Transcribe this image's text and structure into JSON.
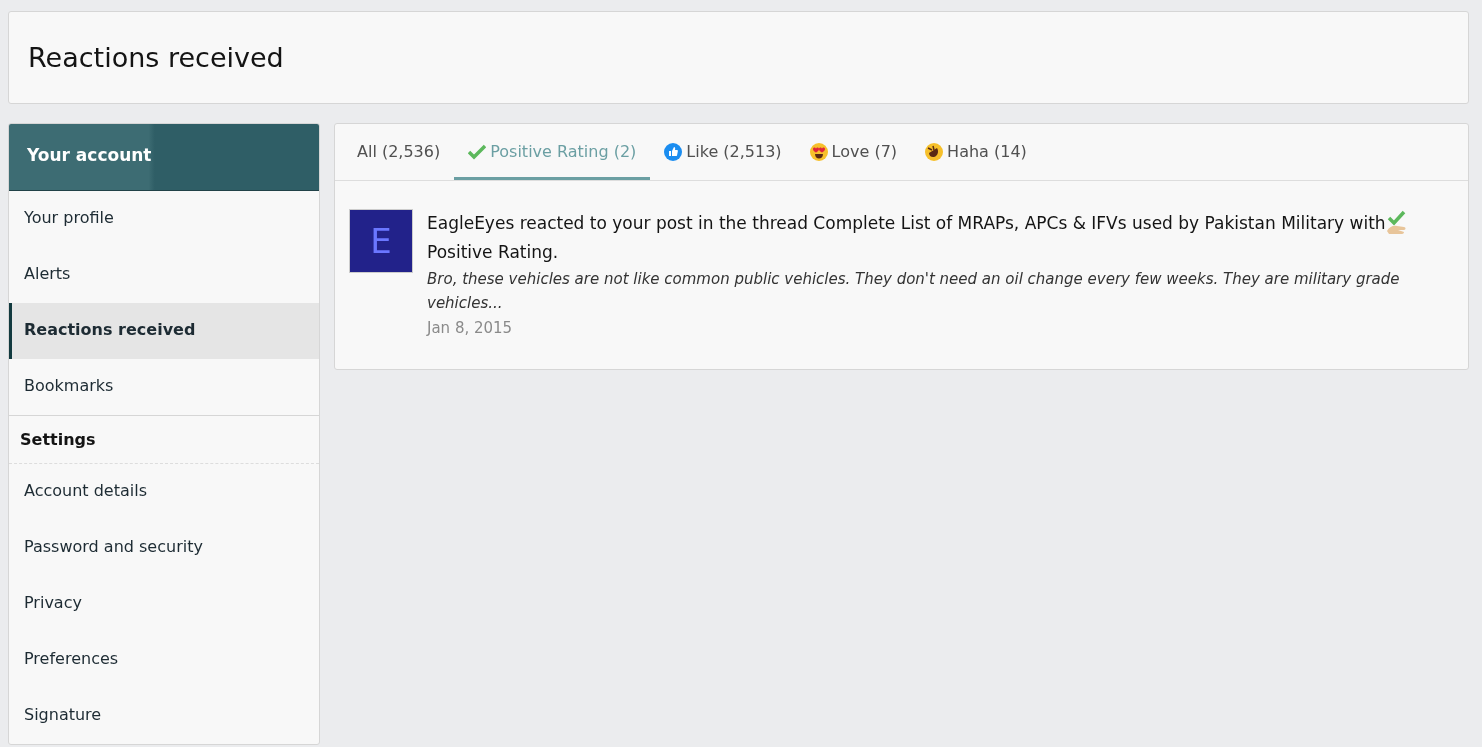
{
  "page_title": "Reactions received",
  "sidebar": {
    "sections": [
      {
        "title": "Your account",
        "kind": "banner",
        "items": [
          {
            "label": "Your profile",
            "selected": false
          },
          {
            "label": "Alerts",
            "selected": false
          },
          {
            "label": "Reactions received",
            "selected": true
          },
          {
            "label": "Bookmarks",
            "selected": false
          }
        ]
      },
      {
        "title": "Settings",
        "kind": "header",
        "items": [
          {
            "label": "Account details",
            "selected": false
          },
          {
            "label": "Password and security",
            "selected": false
          },
          {
            "label": "Privacy",
            "selected": false
          },
          {
            "label": "Preferences",
            "selected": false
          },
          {
            "label": "Signature",
            "selected": false
          }
        ]
      }
    ]
  },
  "tabs": [
    {
      "label": "All (2,536)",
      "kind": "all",
      "selected": false
    },
    {
      "label": "Positive Rating (2)",
      "kind": "check",
      "selected": true
    },
    {
      "label": "Like (2,513)",
      "kind": "like",
      "selected": false
    },
    {
      "label": "Love (7)",
      "kind": "love",
      "selected": false
    },
    {
      "label": "Haha (14)",
      "kind": "haha",
      "selected": false
    }
  ],
  "items": [
    {
      "avatar_letter": "E",
      "message": "EagleEyes reacted to your post in the thread Complete List of MRAPs, APCs & IFVs used by Pakistan Military with",
      "reaction": "Positive Rating.",
      "snippet": "Bro, these vehicles are not like common public vehicles. They don't need an oil change every few weeks. They are military grade vehicles...",
      "date": "Jan 8, 2015"
    }
  ]
}
